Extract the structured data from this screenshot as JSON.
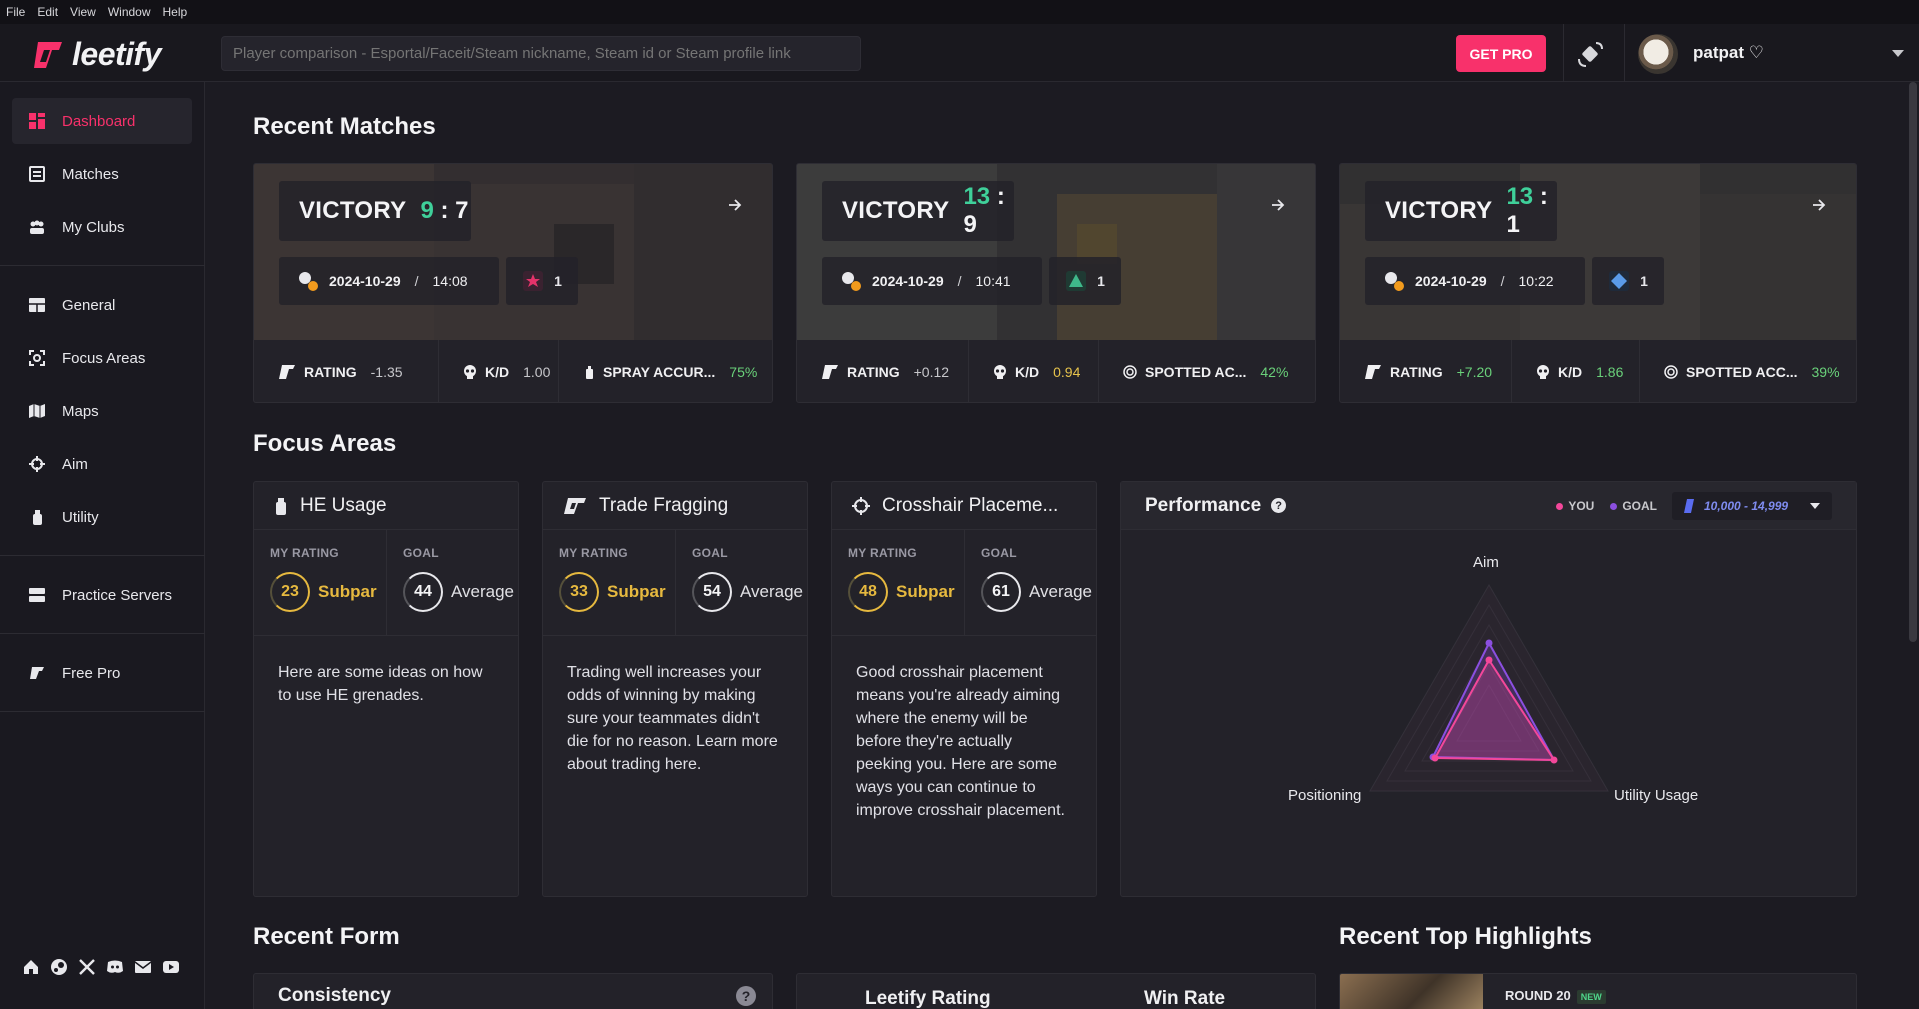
{
  "menu": [
    "File",
    "Edit",
    "View",
    "Window",
    "Help"
  ],
  "header": {
    "logo_text": "leetify",
    "search_placeholder": "Player comparison - Esportal/Faceit/Steam nickname, Steam id or Steam profile link",
    "get_pro_label": "GET PRO",
    "username": "patpat ♡"
  },
  "sidebar": {
    "items": [
      {
        "label": "Dashboard",
        "icon": "dashboard-icon"
      },
      {
        "label": "Matches",
        "icon": "matches-icon"
      },
      {
        "label": "My Clubs",
        "icon": "clubs-icon"
      },
      {
        "label": "General",
        "icon": "general-icon"
      },
      {
        "label": "Focus Areas",
        "icon": "focus-icon"
      },
      {
        "label": "Maps",
        "icon": "map-icon"
      },
      {
        "label": "Aim",
        "icon": "crosshair-icon"
      },
      {
        "label": "Utility",
        "icon": "grenade-icon"
      },
      {
        "label": "Practice Servers",
        "icon": "server-icon"
      },
      {
        "label": "Free Pro",
        "icon": "leetify-icon"
      }
    ],
    "social": [
      "home-icon",
      "steam-icon",
      "x-icon",
      "discord-icon",
      "mail-icon",
      "youtube-icon"
    ]
  },
  "recent_matches": {
    "title": "Recent Matches",
    "matches": [
      {
        "result": "VICTORY",
        "score_us": "9",
        "score_sep": ":",
        "score_them": "7",
        "date": "2024-10-29",
        "sep": "/",
        "time": "14:08",
        "rank_count": "1",
        "rank_color": "#e5336a",
        "rating_label": "RATING",
        "rating": "-1.35",
        "kd_label": "K/D",
        "kd": "1.00",
        "stat3_label": "SPRAY ACCUR...",
        "stat3": "75%"
      },
      {
        "result": "VICTORY",
        "score_us": "13",
        "score_sep": ":",
        "score_them": "9",
        "date": "2024-10-29",
        "sep": "/",
        "time": "10:41",
        "rank_count": "1",
        "rank_color": "#3fb88a",
        "rating_label": "RATING",
        "rating": "+0.12",
        "kd_label": "K/D",
        "kd": "0.94",
        "stat3_label": "SPOTTED AC...",
        "stat3": "42%"
      },
      {
        "result": "VICTORY",
        "score_us": "13",
        "score_sep": ":",
        "score_them": "1",
        "date": "2024-10-29",
        "sep": "/",
        "time": "10:22",
        "rank_count": "1",
        "rank_color": "#5b9be8",
        "rating_label": "RATING",
        "rating": "+7.20",
        "kd_label": "K/D",
        "kd": "1.86",
        "stat3_label": "SPOTTED ACC...",
        "stat3": "39%"
      }
    ]
  },
  "focus_areas": {
    "title": "Focus Areas",
    "cards": [
      {
        "title": "HE Usage",
        "icon": "grenade-icon",
        "my_label": "MY RATING",
        "my_value": "23",
        "my_word": "Subpar",
        "goal_label": "GOAL",
        "goal_value": "44",
        "goal_word": "Average",
        "desc": "Here are some ideas on how to use HE grenades."
      },
      {
        "title": "Trade Fragging",
        "icon": "leetify-icon",
        "my_label": "MY RATING",
        "my_value": "33",
        "my_word": "Subpar",
        "goal_label": "GOAL",
        "goal_value": "54",
        "goal_word": "Average",
        "desc": "Trading well increases your odds of winning by making sure your teammates didn't die for no reason. Learn more about trading here."
      },
      {
        "title": "Crosshair Placeme...",
        "icon": "crosshair-icon",
        "my_label": "MY RATING",
        "my_value": "48",
        "my_word": "Subpar",
        "goal_label": "GOAL",
        "goal_value": "61",
        "goal_word": "Average",
        "desc": "Good crosshair placement means you're already aiming where the enemy will be before they're actually peeking you. Here are some ways you can continue to improve crosshair placement."
      }
    ]
  },
  "performance": {
    "title": "Performance",
    "help": "?",
    "legend_you": "YOU",
    "legend_goal": "GOAL",
    "rank_range": "10,000 - 14,999",
    "axes": [
      "Aim",
      "Utility Usage",
      "Positioning"
    ],
    "you_color": "#f3479a",
    "goal_color": "#8b4fe0"
  },
  "recent_form": {
    "title": "Recent Form",
    "consistency": "Consistency",
    "leetify_rating": "Leetify Rating",
    "win_rate": "Win Rate"
  },
  "highlights": {
    "title": "Recent Top Highlights",
    "round": "ROUND 20",
    "badge": "NEW"
  },
  "colors": {
    "accent": "#f8316b",
    "win": "#3fd09a",
    "subpar": "#e6b93f",
    "positive": "#6ad17a",
    "warning": "#e6c34c"
  }
}
